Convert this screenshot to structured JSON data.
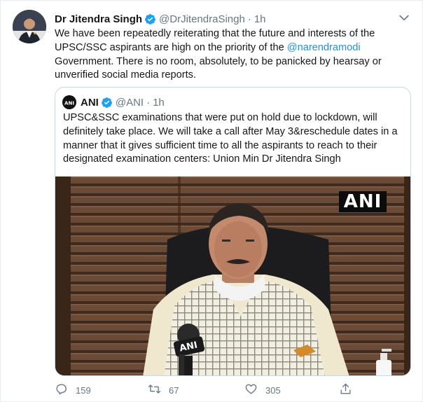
{
  "tweet": {
    "author": {
      "display_name": "Dr Jitendra Singh",
      "handle": "@DrJitendraSingh",
      "time": "1h",
      "separator": "·"
    },
    "text_parts": {
      "before_mention": "We have been repeatedly reiterating that the future and interests of the UPSC/SSC aspirants are high on the priority of the ",
      "mention": "@narendramodi",
      "after_mention": " Government. There is no room, absolutely, to be panicked by hearsay or unverified social media reports."
    },
    "quoted": {
      "display_name": "ANI",
      "handle": "@ANI",
      "separator": "·",
      "time": "1h",
      "text": "UPSC&SSC examinations that were put on hold due to lockdown, will definitely take place. We will take a call after May 3&reschedule dates in a manner that it gives sufficient time to all the aspirants to reach to their designated examination centers: Union Min Dr Jitendra Singh",
      "media_watermark": "ANI",
      "mic_label": "ANI"
    },
    "actions": {
      "reply_count": "159",
      "retweet_count": "67",
      "like_count": "305"
    }
  },
  "icons": {
    "verified": "verified-badge-icon",
    "caret": "chevron-down-icon",
    "reply": "reply-icon",
    "retweet": "retweet-icon",
    "like": "heart-icon",
    "share": "share-icon"
  },
  "colors": {
    "link": "#1b95e0",
    "verified": "#1da1f2",
    "muted": "#657786",
    "border": "#ccd6dd"
  }
}
